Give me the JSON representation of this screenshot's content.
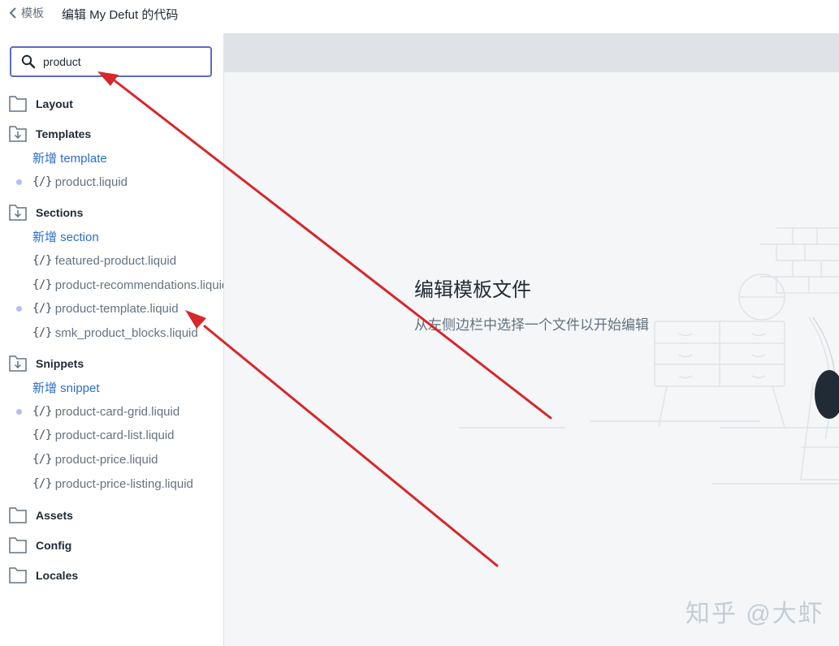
{
  "header": {
    "back_label": "模板",
    "title": "编辑 My Defut 的代码"
  },
  "search": {
    "value": "product"
  },
  "tree": {
    "layout": "Layout",
    "templates": "Templates",
    "templates_add": "新增 template",
    "templates_files": [
      "product.liquid"
    ],
    "sections": "Sections",
    "sections_add": "新增 section",
    "sections_files": [
      "featured-product.liquid",
      "product-recommendations.liquid",
      "product-template.liquid",
      "smk_product_blocks.liquid"
    ],
    "snippets": "Snippets",
    "snippets_add": "新增 snippet",
    "snippets_files": [
      "product-card-grid.liquid",
      "product-card-list.liquid",
      "product-price.liquid",
      "product-price-listing.liquid"
    ],
    "assets": "Assets",
    "config": "Config",
    "locales": "Locales",
    "code_glyph": "{/}"
  },
  "main": {
    "empty_title": "编辑模板文件",
    "empty_subtitle": "从左侧边栏中选择一个文件以开始编辑"
  },
  "watermark": "知乎 @大虾",
  "colors": {
    "accent": "#5c6ac4",
    "link": "#2c6ecb",
    "arrow": "#d6272b",
    "modified_dot": "#b3bcf5"
  }
}
